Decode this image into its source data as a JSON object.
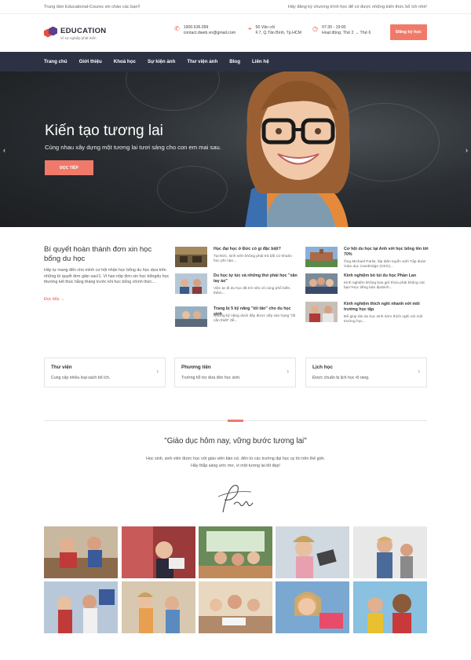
{
  "topbar": {
    "left": "Trung tâm Educational-Coures xin chào các bạn!!",
    "right": "Hãy đăng ký chương trình học để có được những kiến thức bổ ích nhé!"
  },
  "header": {
    "logo_name": "EDUCATION",
    "logo_tagline": "Vì sự nghiệp phát triển",
    "phone": "1900.636.099",
    "email": "contact.dweb.vn@gmail.com",
    "address_line1": "56 Vân côi",
    "address_line2": "F.7, Q.Tân Bình, Tp.HCM",
    "hours_line1": "07:30 - 19:00",
    "hours_line2": "Hoạt động: Thứ 2 → Thứ 6",
    "register_label": "Đăng ký học",
    "icons": [
      "phone-icon",
      "location-icon",
      "clock-icon"
    ]
  },
  "nav": {
    "items": [
      "Trang chủ",
      "Giới thiệu",
      "Khoá học",
      "Sự kiện ảnh",
      "Thư viện ảnh",
      "Blog",
      "Liên hệ"
    ]
  },
  "hero": {
    "title": "Kiến tạo tương lai",
    "subtitle": "Cùng nhau xây dựng một tương lai tươi sáng cho con em mai sau.",
    "button": "ĐỌC TIẾP"
  },
  "featured": {
    "title": "Bí quyết hoàn thành đơn xin học bổng du học",
    "desc": "Hãy tự mang đến cho mình cơ hội nhận học bổng du học dựa trên những bí quyết đơn giản sau!1. Vì hạn nộp đơn xin học bổngdu học thường kết thúc hằng tháng trước khi học bổng chính thức...",
    "more": "Đọc tiếp →"
  },
  "news": [
    {
      "title": "Học đại học ở Đức có gì đặc biệt?",
      "desc": "Tại Đức, sinh viên không phải trả bất cứ khoản học phí nào..."
    },
    {
      "title": "Du học tự túc và những thứ phải học \"xăn tay áo\"",
      "desc": "Việc tự đi du học đã trở nên vô cùng phổ biến, thêm..."
    },
    {
      "title": "Trang bị 5 kỹ năng \"tối tân\" cho du học sinh",
      "desc": "Những kỹ năng dưới đây được xếp vào hạng \"tối cần thiết\" để..."
    },
    {
      "title": "Cơ hội du học tại Anh với học bổng lên tới 70%",
      "desc": "Ông Michael Parlis, đại diện tuyển sinh Tập đoàn Giáo dục Cambridge (CEG)..."
    },
    {
      "title": "Kinh nghiệm bỏ túi du học Phần Lan",
      "desc": "Kinh nghiệm không bao giờ thừa phải không các bạn?Học tiếng bản địaSinh..."
    },
    {
      "title": "Kinh nghiệm thích nghi nhanh với môi trường học tập",
      "desc": "Để giúp tân du học sinh sớm thích nghi với môi trường học..."
    }
  ],
  "cards": [
    {
      "title": "Thư viện",
      "desc": "Cung cấp nhiều loại sách bổ ích."
    },
    {
      "title": "Phương tiện",
      "desc": "Trường hỗ trợ đưa đón học sinh."
    },
    {
      "title": "Lịch học",
      "desc": "Được chuẩn bị lịch học rõ ràng."
    }
  ],
  "quote": {
    "title": "\"Giáo dục hôm nay, vững bước tương lai\"",
    "line1": "Học sinh, sinh viên được học với giáo viên bản xứ, đến từ các trường đại học uy tín trên thế giới.",
    "line2": "Hãy thắp sáng ước mơ, vì một tương lai tốt đẹp!",
    "signature": "Pame"
  },
  "colors": {
    "accent": "#f07a6a",
    "nav_bg": "#2c3143",
    "logo_red": "#e84c3d",
    "logo_purple": "#5a3f8c"
  }
}
